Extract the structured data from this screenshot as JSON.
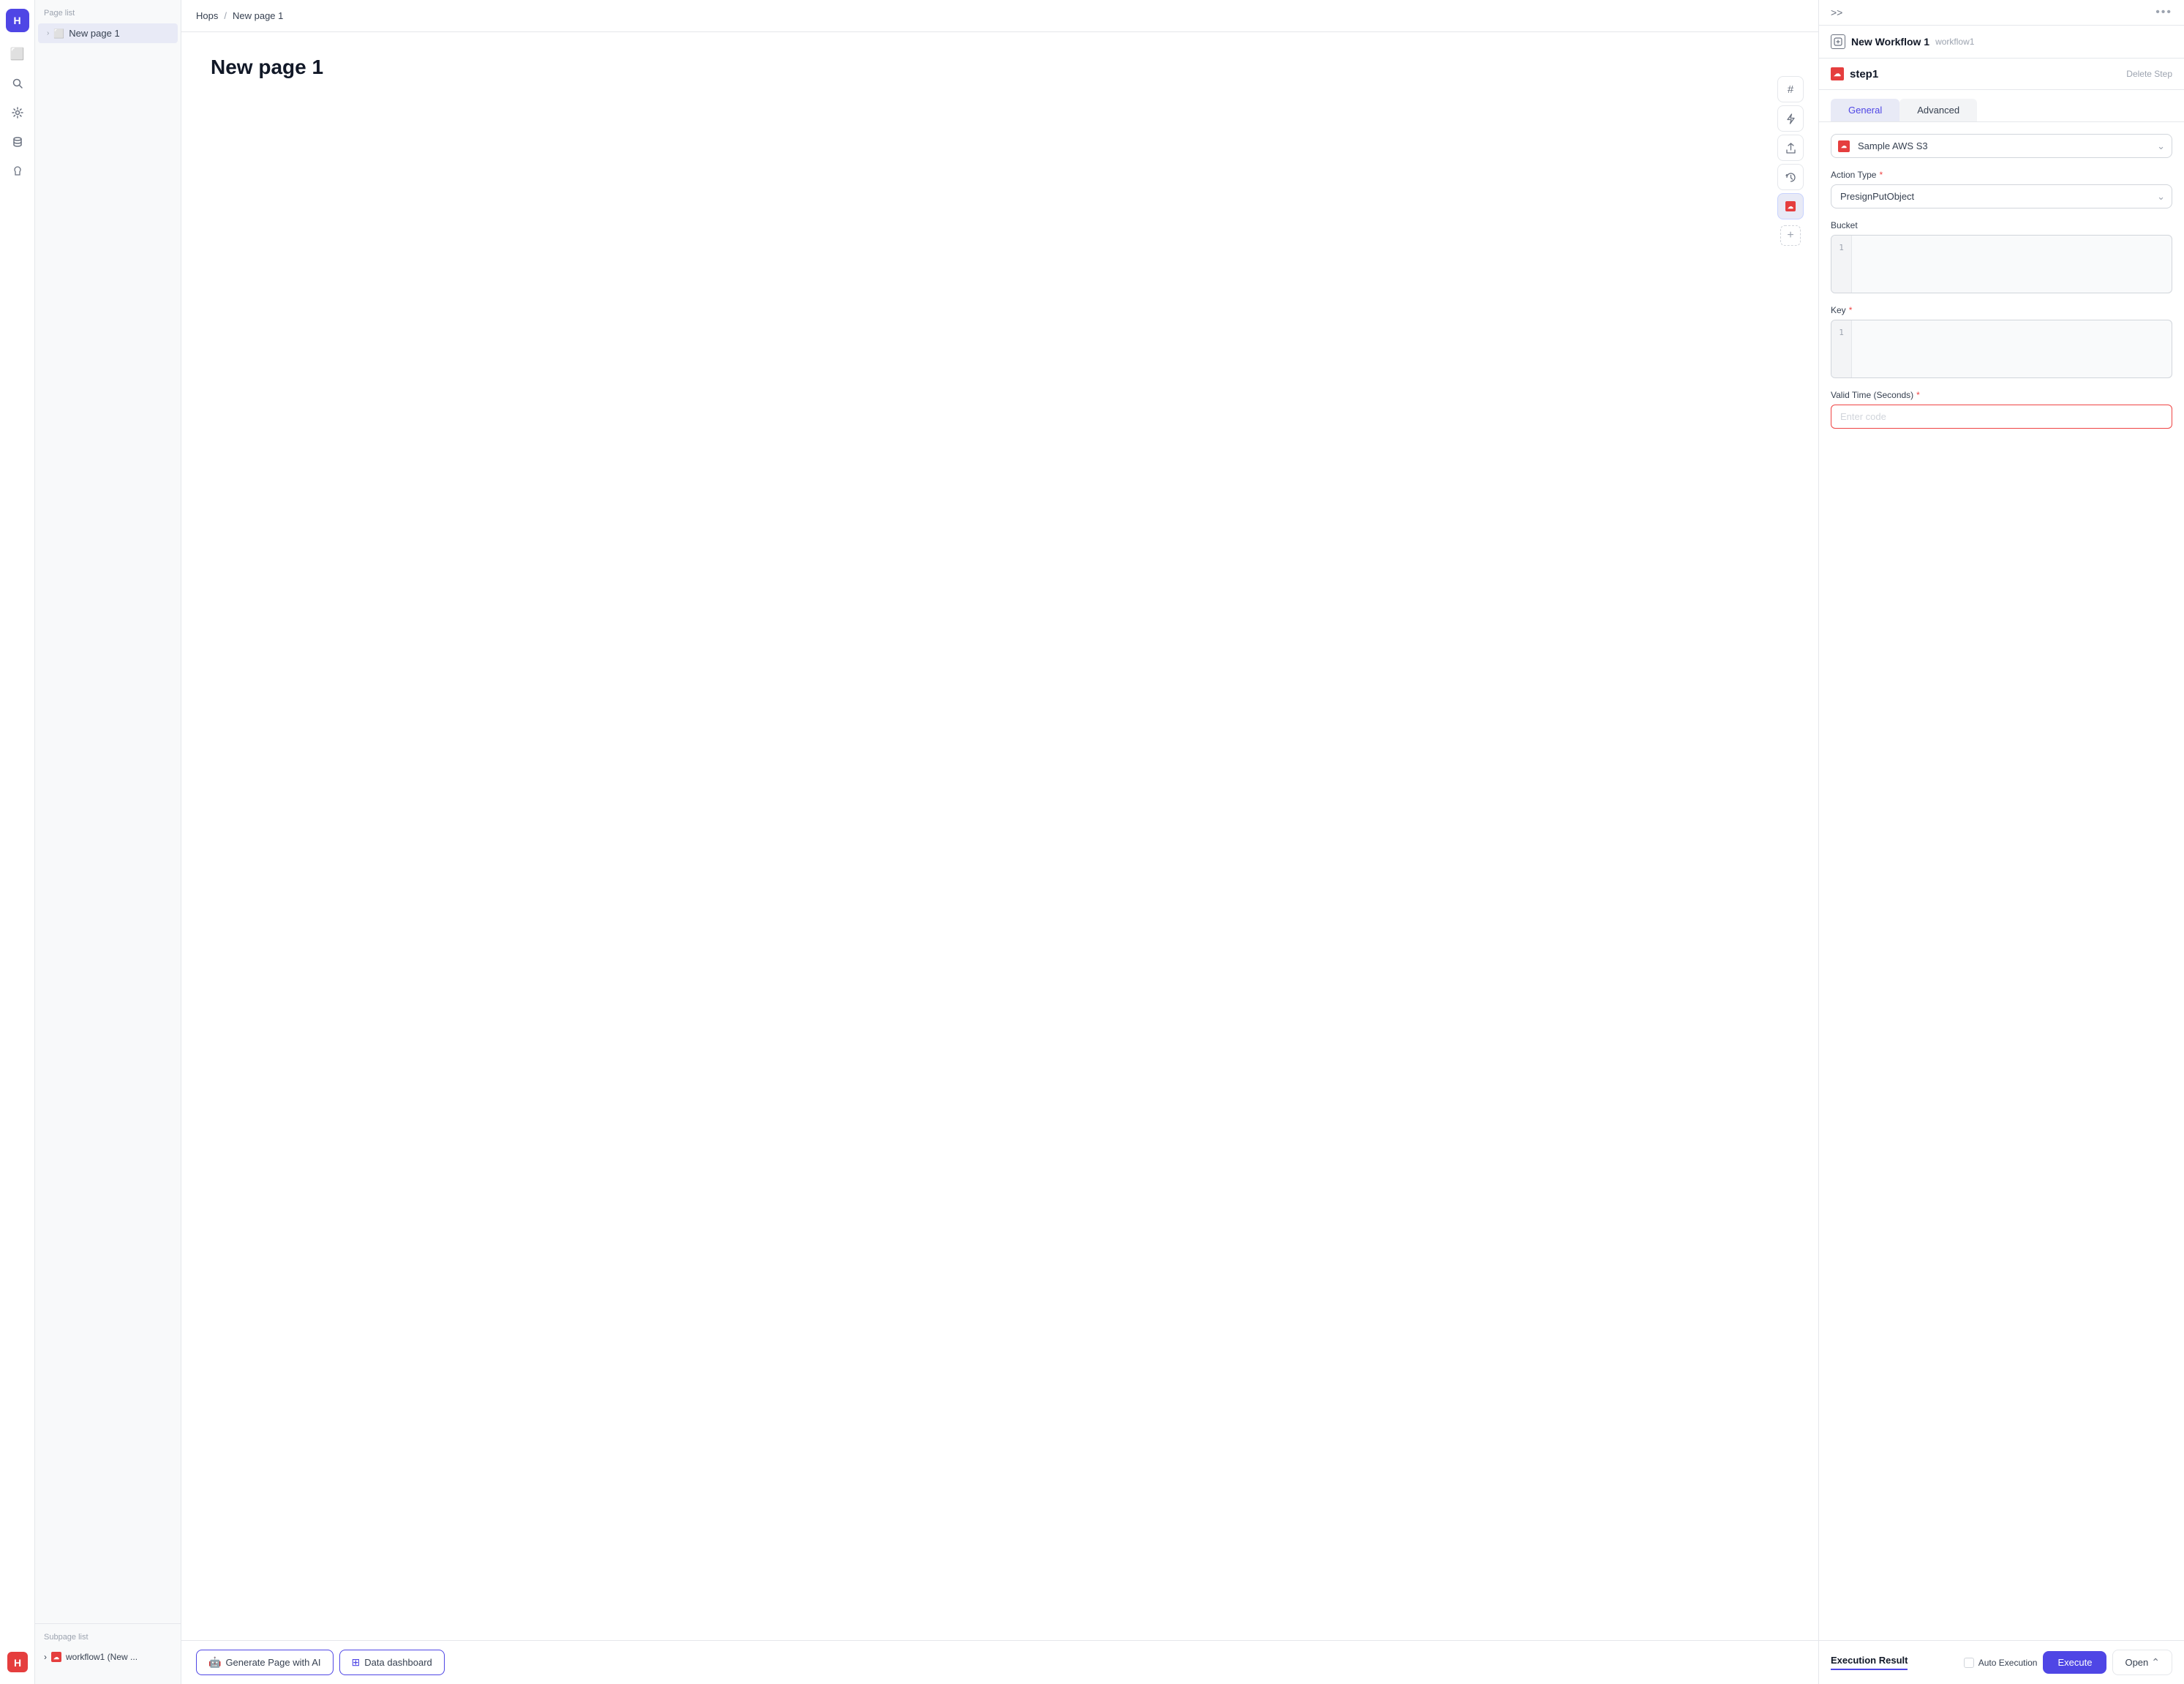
{
  "nav": {
    "top_icon": "H",
    "items": [
      {
        "id": "pages",
        "icon": "⬜",
        "label": "pages-icon"
      },
      {
        "id": "search",
        "icon": "🔍",
        "label": "search-icon"
      },
      {
        "id": "settings",
        "icon": "⚙️",
        "label": "settings-icon"
      },
      {
        "id": "database",
        "icon": "🗄️",
        "label": "database-icon"
      },
      {
        "id": "brain",
        "icon": "🧠",
        "label": "brain-icon"
      }
    ]
  },
  "page_sidebar": {
    "title": "Page list",
    "items": [
      {
        "label": "New page 1",
        "active": true
      }
    ],
    "subpage_title": "Subpage list",
    "subitems": [
      {
        "label": "workflow1 (New ...",
        "icon": "aws"
      }
    ]
  },
  "breadcrumb": {
    "parent": "Hops",
    "separator": "/",
    "current": "New page 1"
  },
  "page": {
    "title": "New page 1"
  },
  "toolbar": {
    "buttons": [
      {
        "id": "hash",
        "icon": "#",
        "label": "hash-icon"
      },
      {
        "id": "bolt",
        "icon": "⚡",
        "label": "bolt-icon"
      },
      {
        "id": "share",
        "icon": "↗",
        "label": "share-icon"
      },
      {
        "id": "history",
        "icon": "↩",
        "label": "history-icon"
      }
    ],
    "active_id": "aws-step",
    "add_label": "+"
  },
  "bottom_bar": {
    "buttons": [
      {
        "id": "generate-ai",
        "label": "Generate Page with AI",
        "icon": "🤖"
      },
      {
        "id": "data-dashboard",
        "label": "Data dashboard",
        "icon": "⊞"
      }
    ]
  },
  "right_panel": {
    "header": {
      "workflow_title": "New Workflow 1",
      "workflow_id": "workflow1",
      "expand_icon": ">>",
      "more_icon": "..."
    },
    "step": {
      "title": "step1",
      "delete_label": "Delete Step"
    },
    "tabs": [
      {
        "id": "general",
        "label": "General",
        "active": true
      },
      {
        "id": "advanced",
        "label": "Advanced",
        "active": false
      }
    ],
    "data_source": {
      "label": "Sample AWS S3"
    },
    "action_type": {
      "label": "Action Type",
      "required": true,
      "value": "PresignPutObject"
    },
    "bucket": {
      "label": "Bucket",
      "required": false,
      "line_number": "1"
    },
    "key": {
      "label": "Key",
      "required": true,
      "line_number": "1"
    },
    "valid_time": {
      "label": "Valid Time (Seconds)",
      "required": true,
      "placeholder": "Enter code"
    },
    "footer": {
      "execution_result_label": "Execution Result",
      "auto_execution_label": "Auto Execution",
      "execute_btn_label": "Execute",
      "open_btn_label": "Open"
    }
  }
}
